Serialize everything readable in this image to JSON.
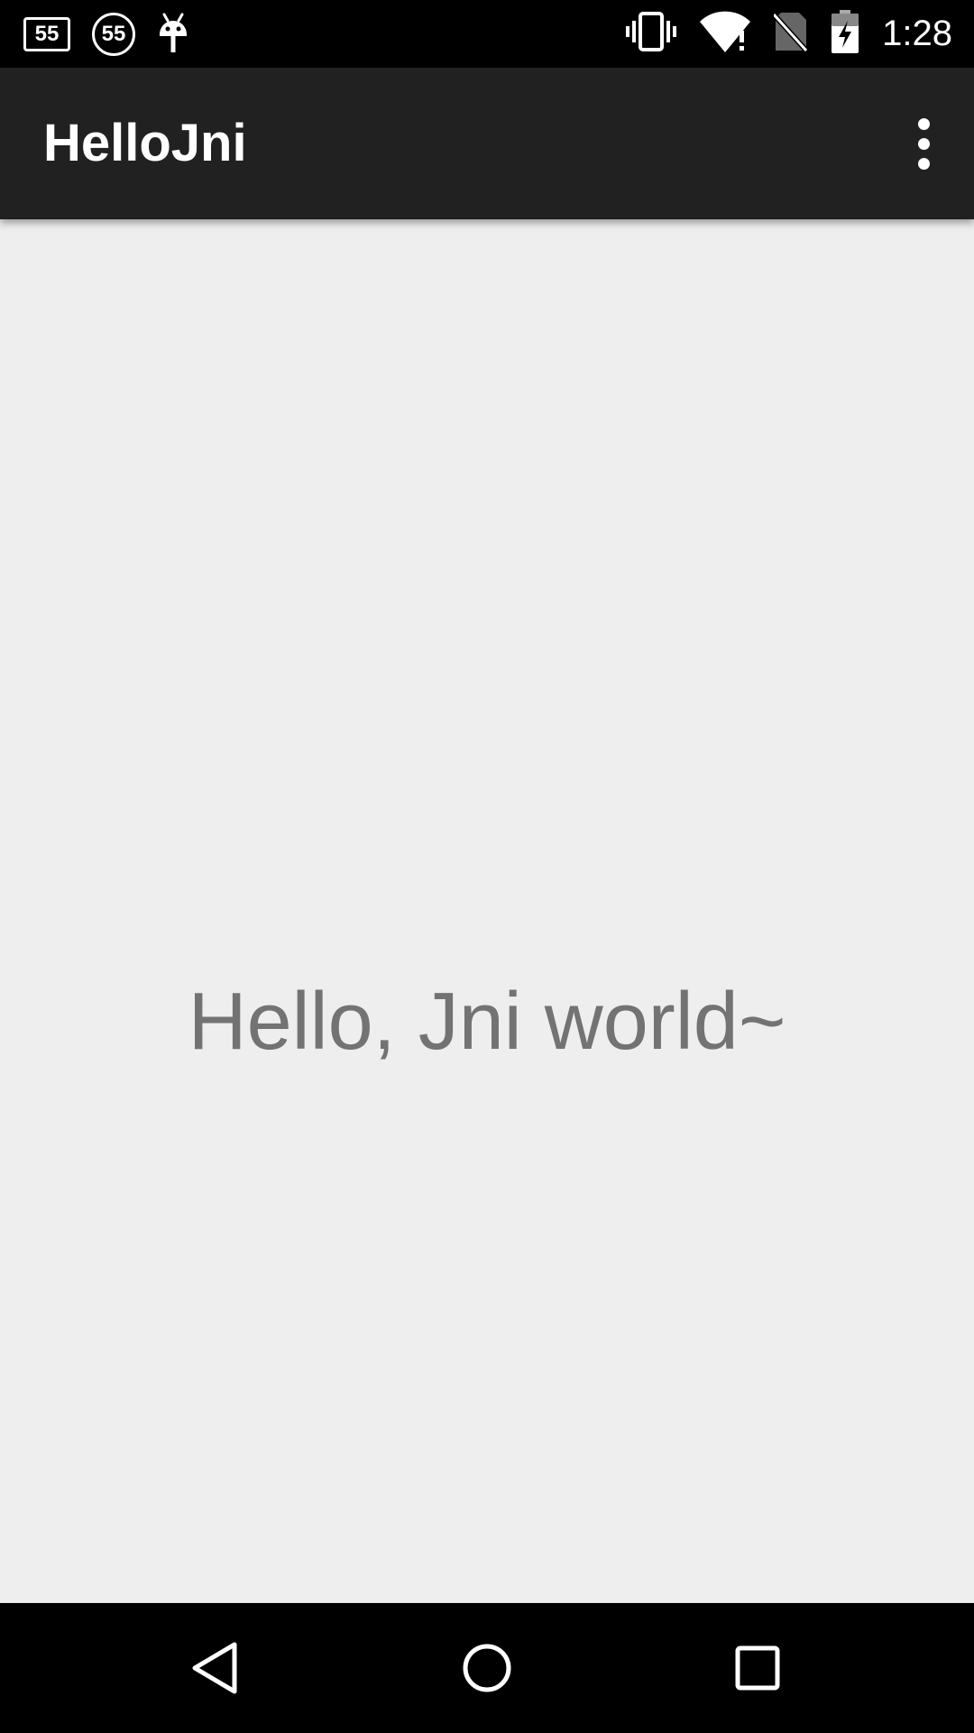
{
  "status_bar": {
    "notifications": [
      {
        "icon": "sim-card-55-icon",
        "label": "55"
      },
      {
        "icon": "circle-55-icon",
        "label": "55"
      },
      {
        "icon": "android-debug-icon"
      }
    ],
    "system_icons": [
      "vibrate-icon",
      "wifi-alert-icon",
      "no-sim-icon",
      "battery-charging-icon"
    ],
    "time": "1:28"
  },
  "app_bar": {
    "title": "HelloJni",
    "overflow_icon": "more-vert-icon"
  },
  "content": {
    "message": "Hello, Jni world~"
  },
  "nav_bar": {
    "buttons": [
      "back-icon",
      "home-icon",
      "recents-icon"
    ]
  },
  "colors": {
    "status_bar": "#000000",
    "app_bar": "#212121",
    "background": "#eeeeee",
    "message_text": "#737373",
    "nav_bar": "#000000"
  }
}
